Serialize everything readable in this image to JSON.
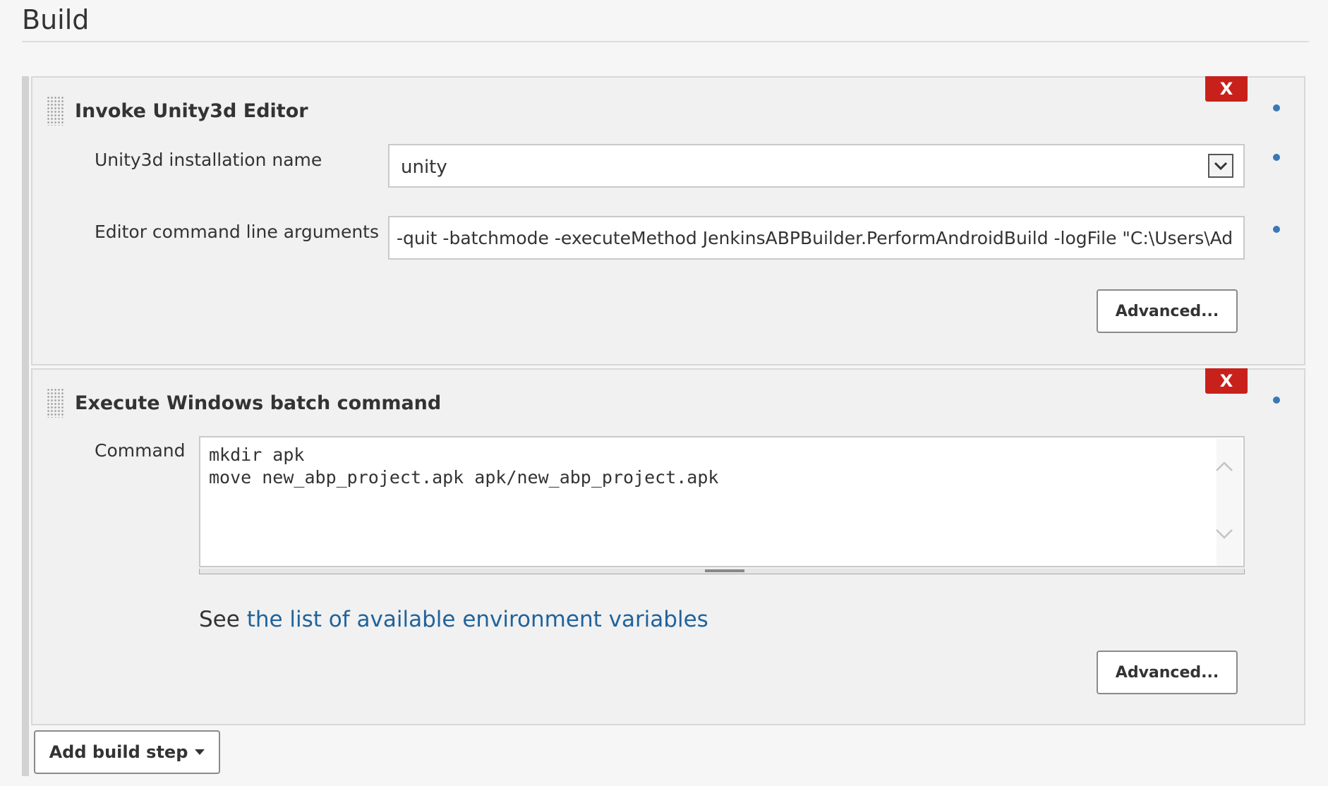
{
  "section": {
    "title": "Build"
  },
  "steps": [
    {
      "title": "Invoke Unity3d Editor",
      "delete_label": "X",
      "fields": {
        "installation_label": "Unity3d installation name",
        "installation_value": "unity",
        "args_label": "Editor command line arguments",
        "args_value": "-quit -batchmode -executeMethod JenkinsABPBuilder.PerformAndroidBuild -logFile \"C:\\Users\\Ad"
      },
      "advanced_label": "Advanced..."
    },
    {
      "title": "Execute Windows batch command",
      "delete_label": "X",
      "command_label": "Command",
      "command_lines": [
        "mkdir apk",
        "move new_abp_project.apk apk/new_abp_project.apk"
      ],
      "help_prefix": "See ",
      "help_link": "the list of available environment variables",
      "advanced_label": "Advanced..."
    }
  ],
  "add_step_label": "Add build step",
  "colors": {
    "delete": "#c8211b",
    "link": "#20639b",
    "help_dot": "#3a78b5"
  }
}
